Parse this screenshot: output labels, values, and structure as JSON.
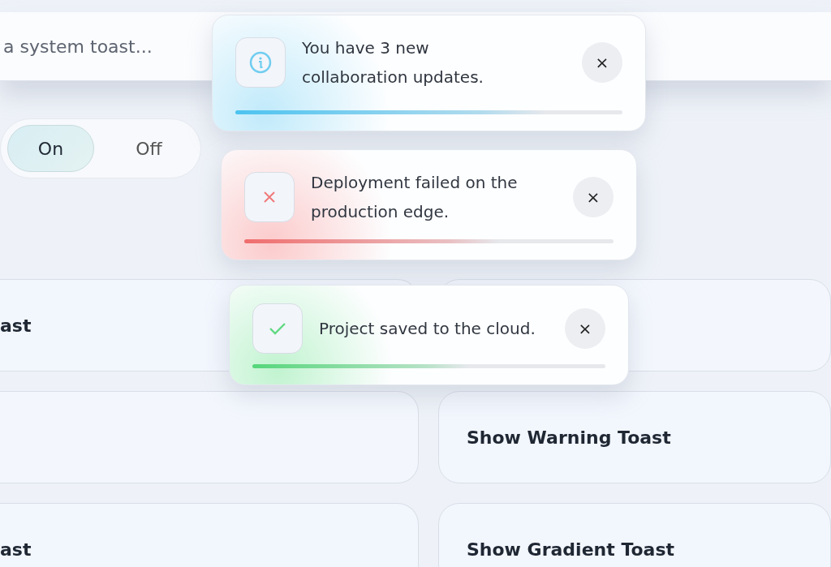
{
  "search": {
    "placeholder": "a system toast..."
  },
  "toggle": [
    {
      "label": "On",
      "selected": true
    },
    {
      "label": "Off",
      "selected": false
    }
  ],
  "buttons": [
    {
      "kind": "labeled",
      "label": "ast"
    },
    {
      "kind": "blank"
    },
    {
      "kind": "blank"
    },
    {
      "kind": "labeled",
      "label": "Show Warning Toast"
    },
    {
      "kind": "labeled",
      "label": "ast"
    },
    {
      "kind": "labeled",
      "label": "Show Gradient Toast"
    }
  ],
  "toasts": [
    {
      "kind": "info",
      "message": "You have 3 new collaboration updates.",
      "close": "×",
      "level": 0.8
    },
    {
      "kind": "error",
      "message": "Deployment failed on the production edge.",
      "close": "×",
      "level": 0.69
    },
    {
      "kind": "success",
      "message": "Project saved to the cloud.",
      "close": "×",
      "level": 0.61
    }
  ]
}
